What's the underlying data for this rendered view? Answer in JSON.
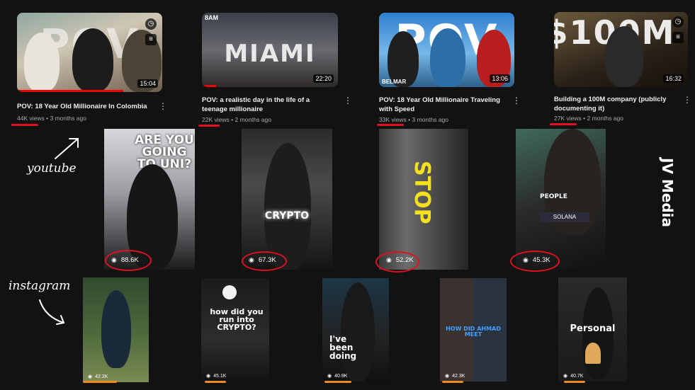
{
  "youtube": {
    "videos": [
      {
        "overlay": "POV",
        "title": "POV: 18 Year Old Millionaire In Colombia",
        "views": "44K views",
        "age": "3 months ago",
        "duration": "15:04"
      },
      {
        "overlay": "MIAMI",
        "channel_tag": "8AM",
        "title": "POV: a realistic day in the life of a teenage millionaire",
        "views": "22K views",
        "age": "2 months ago",
        "duration": "22:20"
      },
      {
        "overlay": "POV",
        "channel_tag": "BELMAR",
        "title": "POV: 18 Year Old Millionaire Traveling with Speed",
        "views": "33K views",
        "age": "3 months ago",
        "duration": "13:06"
      },
      {
        "overlay": "$100M",
        "title": "Building a 100M company (publicly documenting it)",
        "views": "27K views",
        "age": "2 months ago",
        "duration": "16:32"
      }
    ],
    "separator": "•",
    "menu_glyph": "⋮"
  },
  "reels": [
    {
      "overlay": "ARE YOU GOING TO UNI?",
      "views": "88.6K"
    },
    {
      "overlay": "CRYPTO",
      "views": "67.3K"
    },
    {
      "overlay": "STOP",
      "views": "52.2K"
    },
    {
      "overlay": "PEOPLE",
      "ticker": "SOLANA",
      "views": "45.3K"
    }
  ],
  "instagram": [
    {
      "overlay": "",
      "views": "42.2K"
    },
    {
      "overlay": "how did you run into CRYPTO?",
      "views": "45.1K"
    },
    {
      "overlay": "I've been doing",
      "views": "40.9K"
    },
    {
      "overlay": "HOW DID AHMAD MEET",
      "views": "42.3K"
    },
    {
      "overlay": "Personal",
      "views": "40.7K"
    }
  ],
  "annotations": {
    "youtube": "youtube",
    "instagram": "instagram",
    "brand": "JV Media"
  },
  "colors": {
    "accent_red": "#e01020",
    "accent_orange": "#f08a1a",
    "background": "#121212"
  }
}
